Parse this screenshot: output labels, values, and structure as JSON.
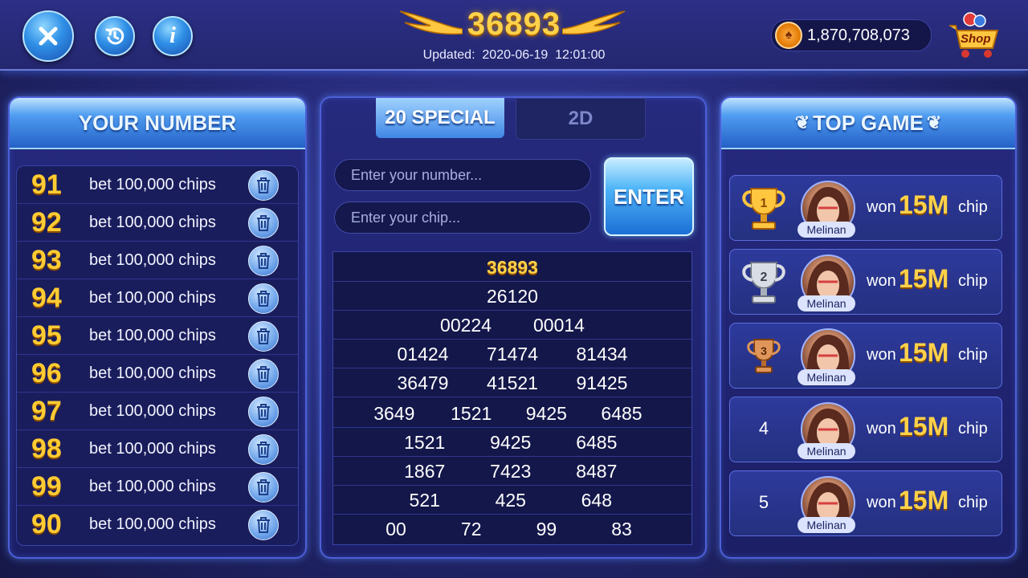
{
  "topbar": {
    "jackpot": "36893",
    "updated_label": "Updated:",
    "updated_date": "2020-06-19",
    "updated_time": "12:01:00",
    "chip_balance": "1,870,708,073",
    "shop_label": "Shop"
  },
  "left_panel": {
    "title": "YOUR NUMBER",
    "rows": [
      {
        "number": "91",
        "bet": "bet 100,000 chips"
      },
      {
        "number": "92",
        "bet": "bet 100,000 chips"
      },
      {
        "number": "93",
        "bet": "bet 100,000 chips"
      },
      {
        "number": "94",
        "bet": "bet 100,000 chips"
      },
      {
        "number": "95",
        "bet": "bet 100,000 chips"
      },
      {
        "number": "96",
        "bet": "bet 100,000 chips"
      },
      {
        "number": "97",
        "bet": "bet 100,000 chips"
      },
      {
        "number": "98",
        "bet": "bet 100,000 chips"
      },
      {
        "number": "99",
        "bet": "bet 100,000 chips"
      },
      {
        "number": "90",
        "bet": "bet 100,000 chips"
      }
    ]
  },
  "middle_panel": {
    "tabs": [
      {
        "label": "20 SPECIAL",
        "active": true
      },
      {
        "label": "2D",
        "active": false
      }
    ],
    "number_placeholder": "Enter your number...",
    "chip_placeholder": "Enter your chip...",
    "enter_label": "ENTER",
    "results": [
      [
        "36893"
      ],
      [
        "26120"
      ],
      [
        "00224",
        "00014"
      ],
      [
        "01424",
        "71474",
        "81434"
      ],
      [
        "36479",
        "41521",
        "91425"
      ],
      [
        "3649",
        "1521",
        "9425",
        "6485"
      ],
      [
        "1521",
        "9425",
        "6485"
      ],
      [
        "1867",
        "7423",
        "8487"
      ],
      [
        "521",
        "425",
        "648"
      ],
      [
        "00",
        "72",
        "99",
        "83"
      ]
    ]
  },
  "right_panel": {
    "title": "TOP GAME",
    "entries": [
      {
        "rank": "1",
        "name": "Melinan",
        "won": "won",
        "amount": "15M",
        "unit": "chip",
        "rank_style": "gold-trophy"
      },
      {
        "rank": "2",
        "name": "Melinan",
        "won": "won",
        "amount": "15M",
        "unit": "chip",
        "rank_style": "silver-trophy"
      },
      {
        "rank": "3",
        "name": "Melinan",
        "won": "won",
        "amount": "15M",
        "unit": "chip",
        "rank_style": "bronze-trophy"
      },
      {
        "rank": "4",
        "name": "Melinan",
        "won": "won",
        "amount": "15M",
        "unit": "chip",
        "rank_style": "plain"
      },
      {
        "rank": "5",
        "name": "Melinan",
        "won": "won",
        "amount": "15M",
        "unit": "chip",
        "rank_style": "plain"
      }
    ]
  },
  "colors": {
    "accent_gold": "#ffd24a",
    "panel_blue": "#262a7e",
    "button_blue": "#4db4f7"
  }
}
